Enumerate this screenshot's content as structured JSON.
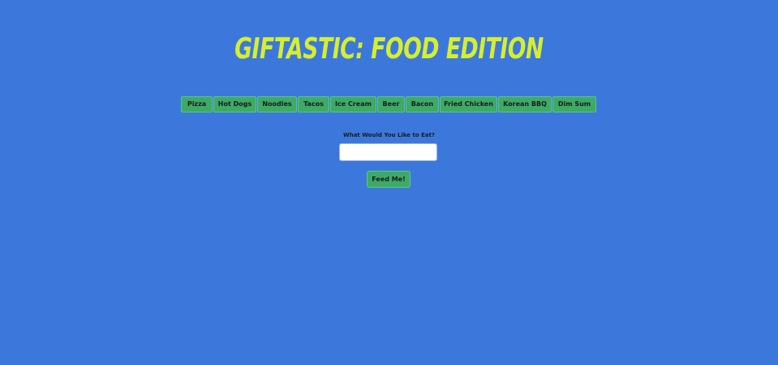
{
  "header": {
    "title": "Giftastic: Food Edition"
  },
  "food_buttons": [
    {
      "label": "Pizza"
    },
    {
      "label": "Hot Dogs"
    },
    {
      "label": "Noodles"
    },
    {
      "label": "Tacos"
    },
    {
      "label": "Ice Cream"
    },
    {
      "label": "Beer"
    },
    {
      "label": "Bacon"
    },
    {
      "label": "Fried Chicken"
    },
    {
      "label": "Korean BBQ"
    },
    {
      "label": "Dim Sum"
    }
  ],
  "form": {
    "label": "What Would You Like to Eat?",
    "input_value": "",
    "submit_label": "Feed Me!"
  },
  "colors": {
    "background": "#3c78dc",
    "title": "#d6ee2e",
    "button": "#3daa68"
  }
}
